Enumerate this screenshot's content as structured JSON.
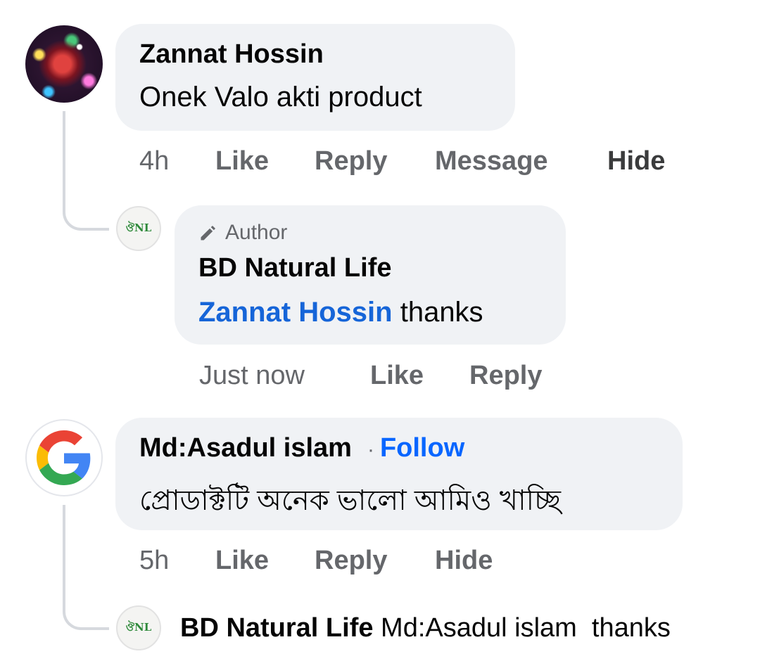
{
  "comments": [
    {
      "author": "Zannat Hossin",
      "text": "Onek Valo akti product",
      "time": "4h",
      "actions": [
        "Like",
        "Reply",
        "Message",
        "Hide"
      ],
      "reply": {
        "badge": "Author",
        "author": "BD Natural Life",
        "mention": "Zannat Hossin",
        "text": " thanks",
        "time": "Just now",
        "actions": [
          "Like",
          "Reply"
        ]
      }
    },
    {
      "author": "Md:Asadul islam",
      "follow_separator": "·",
      "follow": "Follow",
      "text": "প্রোডাক্টটি অনেক ভালো আমিও খাচ্ছি",
      "time": "5h",
      "actions": [
        "Like",
        "Reply",
        "Hide"
      ],
      "reply_preview": {
        "author": "BD Natural Life",
        "text": "Md:Asadul islam  thanks"
      }
    }
  ],
  "icons": {
    "avatar_1": "profile-photo-lights",
    "page_logo": "bd-natural-life-logo",
    "google": "google-g-logo",
    "author_badge": "pencil-icon"
  },
  "colors": {
    "bubble": "#f0f2f5",
    "link": "#0866ff",
    "meta": "#65676b",
    "thread_line": "#d6d9de"
  }
}
